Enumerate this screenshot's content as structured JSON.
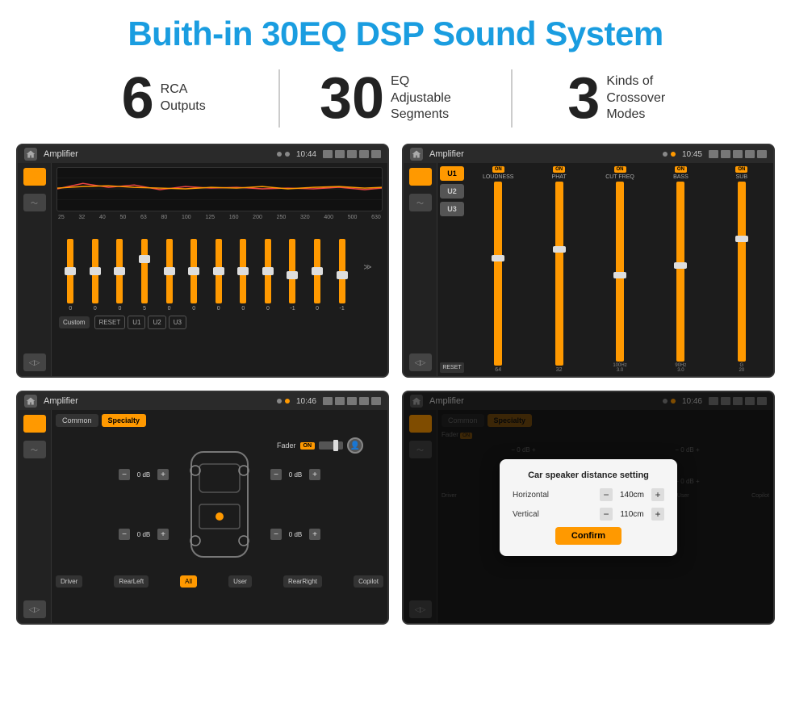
{
  "header": {
    "title": "Buith-in 30EQ DSP Sound System"
  },
  "stats": [
    {
      "number": "6",
      "line1": "RCA",
      "line2": "Outputs"
    },
    {
      "number": "30",
      "line1": "EQ Adjustable",
      "line2": "Segments"
    },
    {
      "number": "3",
      "line1": "Kinds of",
      "line2": "Crossover Modes"
    }
  ],
  "screens": {
    "eq": {
      "statusBar": {
        "title": "Amplifier",
        "time": "10:44"
      },
      "freqLabels": [
        "25",
        "32",
        "40",
        "50",
        "63",
        "80",
        "100",
        "125",
        "160",
        "200",
        "250",
        "320",
        "400",
        "500",
        "630"
      ],
      "sliderValues": [
        "0",
        "0",
        "0",
        "5",
        "0",
        "0",
        "0",
        "0",
        "0",
        "-1",
        "0",
        "-1"
      ],
      "bottomButtons": [
        "Custom",
        "RESET",
        "U1",
        "U2",
        "U3"
      ]
    },
    "crossover": {
      "statusBar": {
        "title": "Amplifier",
        "time": "10:45"
      },
      "presets": [
        "U1",
        "U2",
        "U3"
      ],
      "groups": [
        {
          "label": "LOUDNESS",
          "on": true
        },
        {
          "label": "PHAT",
          "on": true
        },
        {
          "label": "CUT FREQ",
          "on": true
        },
        {
          "label": "BASS",
          "on": true
        },
        {
          "label": "SUB",
          "on": true
        }
      ]
    },
    "fader": {
      "statusBar": {
        "title": "Amplifier",
        "time": "10:46"
      },
      "tabs": [
        "Common",
        "Specialty"
      ],
      "activeTab": "Specialty",
      "faderLabel": "Fader",
      "faderOn": "ON",
      "speakers": {
        "left": [
          "0 dB",
          "0 dB"
        ],
        "right": [
          "0 dB",
          "0 dB"
        ]
      },
      "navButtons": [
        "Driver",
        "RearLeft",
        "All",
        "User",
        "RearRight",
        "Copilot"
      ]
    },
    "dialog": {
      "statusBar": {
        "title": "Amplifier",
        "time": "10:46"
      },
      "title": "Car speaker distance setting",
      "horizontal": {
        "label": "Horizontal",
        "value": "140cm"
      },
      "vertical": {
        "label": "Vertical",
        "value": "110cm"
      },
      "confirmLabel": "Confirm"
    }
  }
}
